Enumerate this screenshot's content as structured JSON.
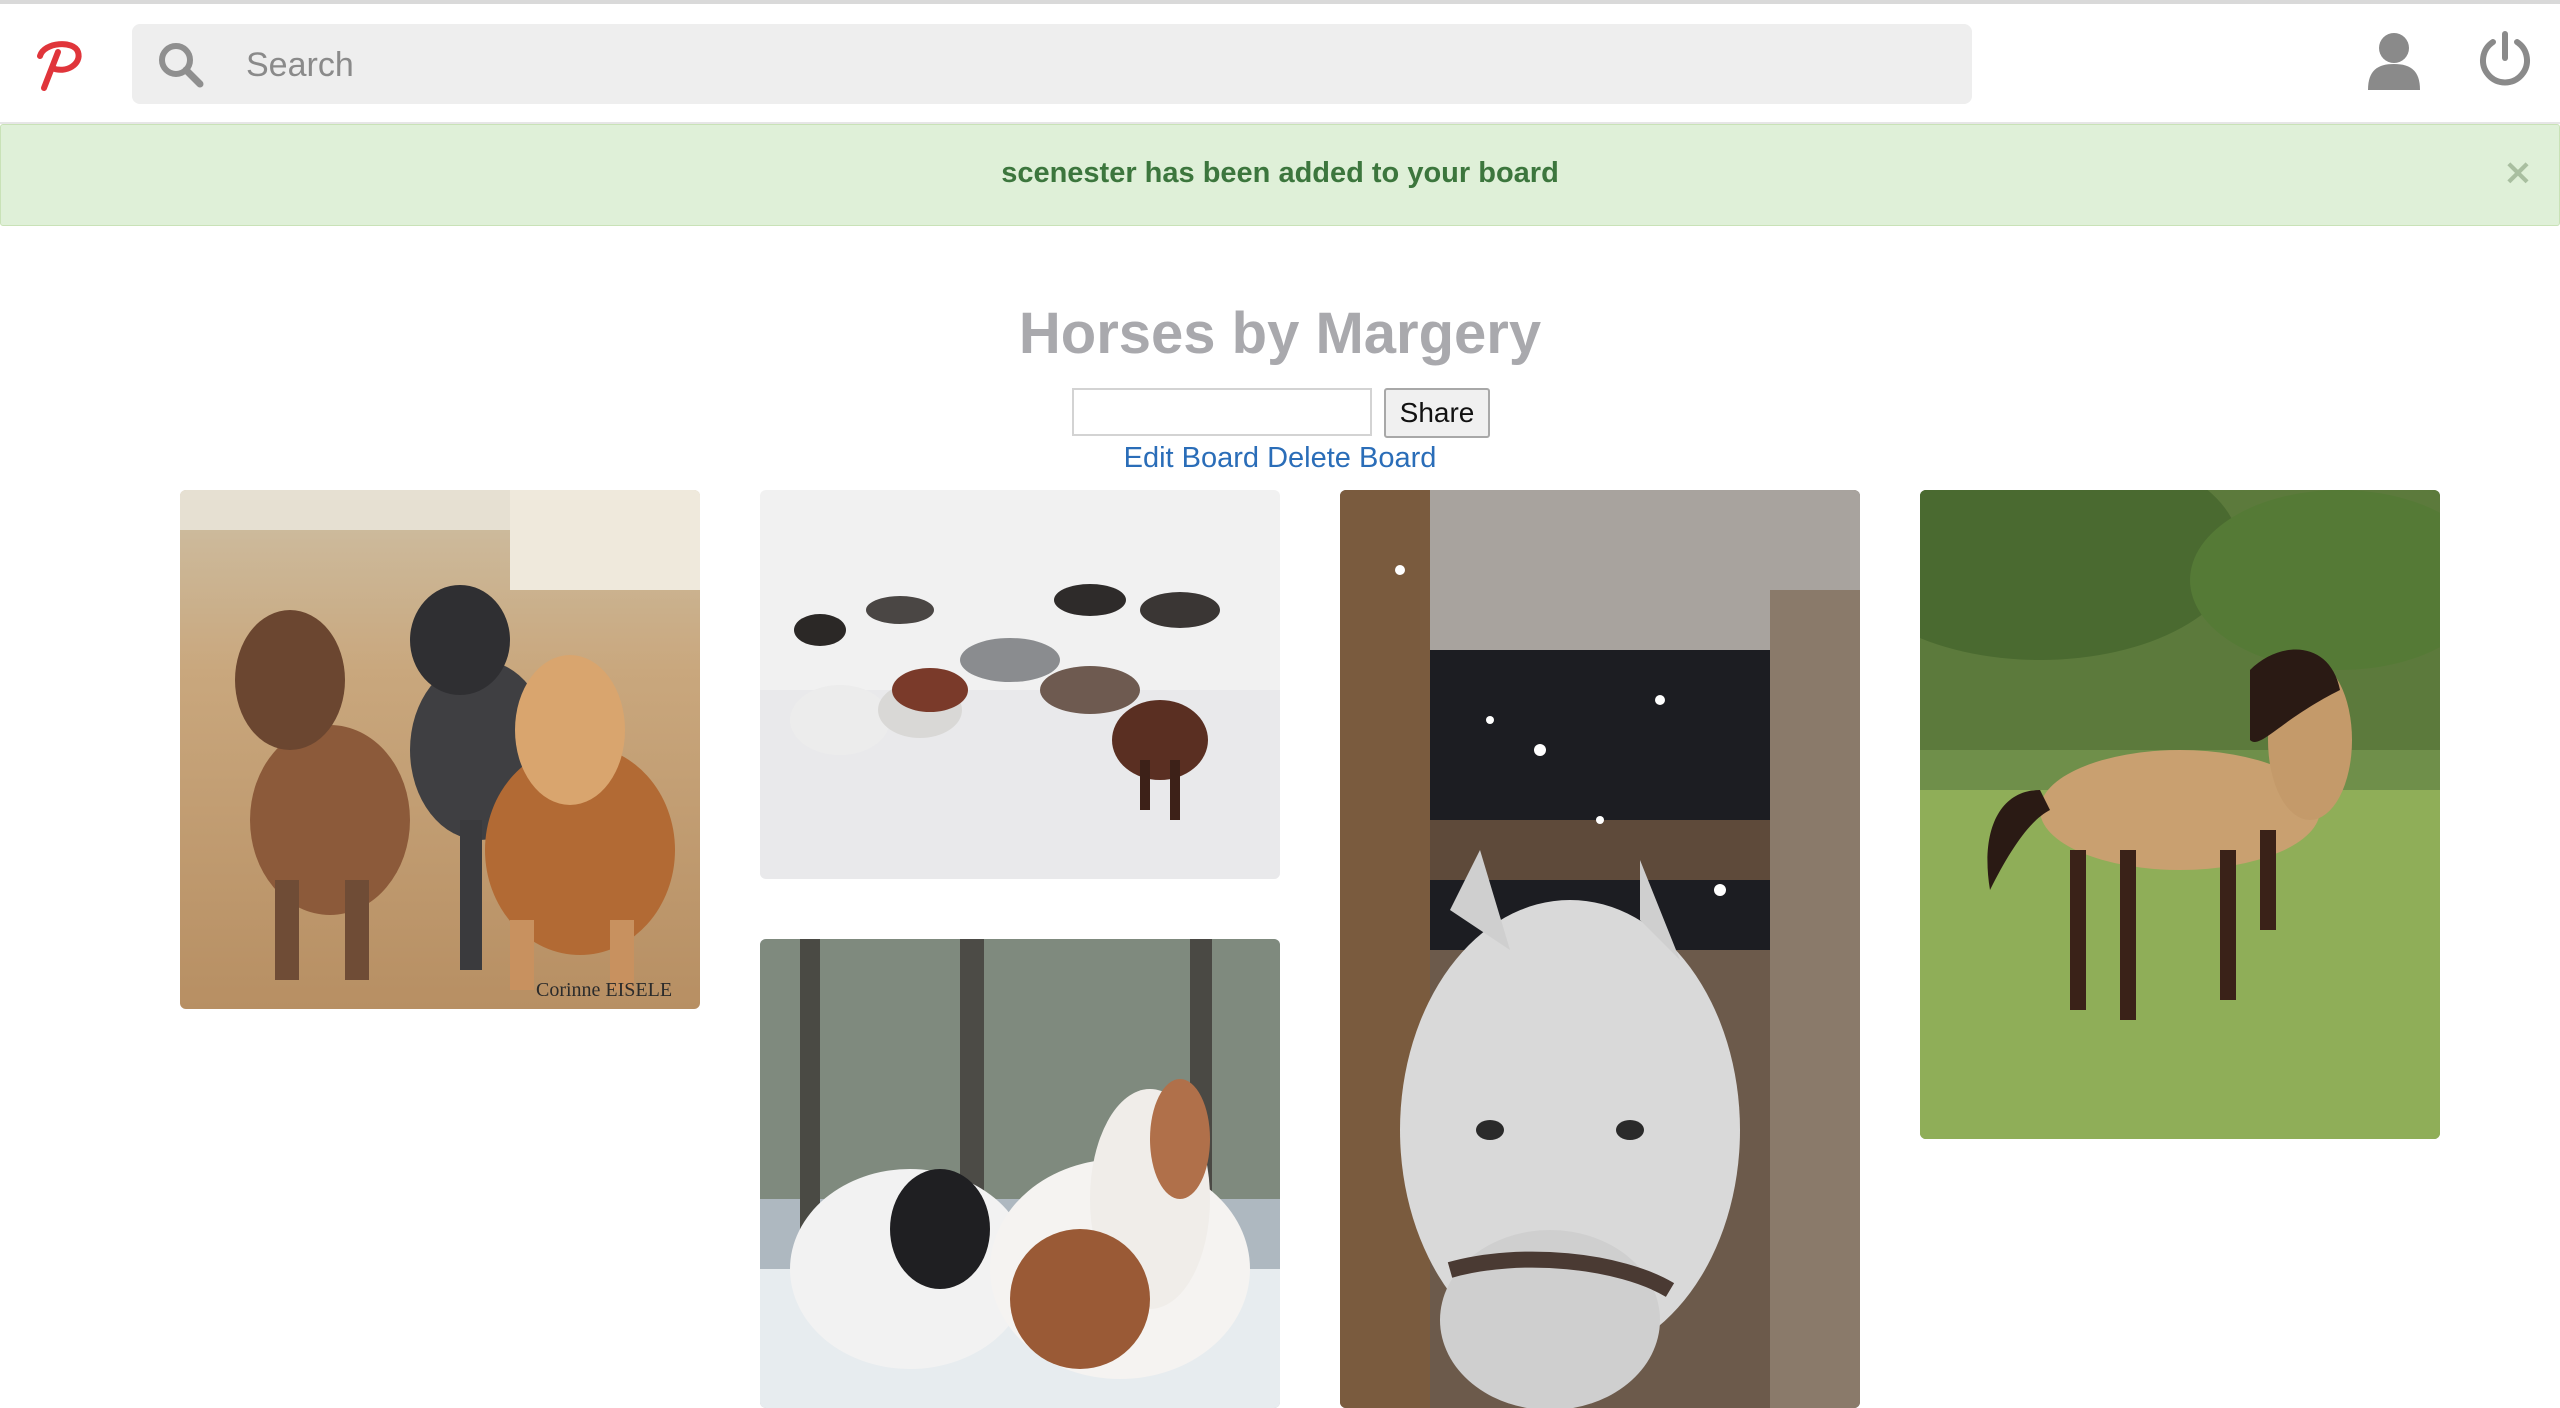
{
  "app": {
    "logo": "pinterest-p-logo"
  },
  "header": {
    "search": {
      "placeholder": "Search",
      "value": ""
    },
    "icons": [
      "search-icon",
      "user-icon",
      "power-icon"
    ]
  },
  "alert": {
    "message": "scenester has been added to your board",
    "close_label": "×",
    "color": "#dff0d8",
    "text_color": "#3c763d"
  },
  "board": {
    "title": "Horses by Margery",
    "share": {
      "input_value": "",
      "button_label": "Share"
    },
    "edit_label": "Edit Board",
    "delete_label": "Delete Board"
  },
  "pins": [
    {
      "subject": "miniature-ponies-photo",
      "watermark": "Corinne EISELE"
    },
    {
      "subject": "horses-running-in-snow-photo"
    },
    {
      "subject": "white-horse-in-snowy-barn-photo"
    },
    {
      "subject": "buckskin-horse-in-field-photo"
    },
    {
      "subject": "pinto-ponies-in-winter-photo"
    }
  ]
}
